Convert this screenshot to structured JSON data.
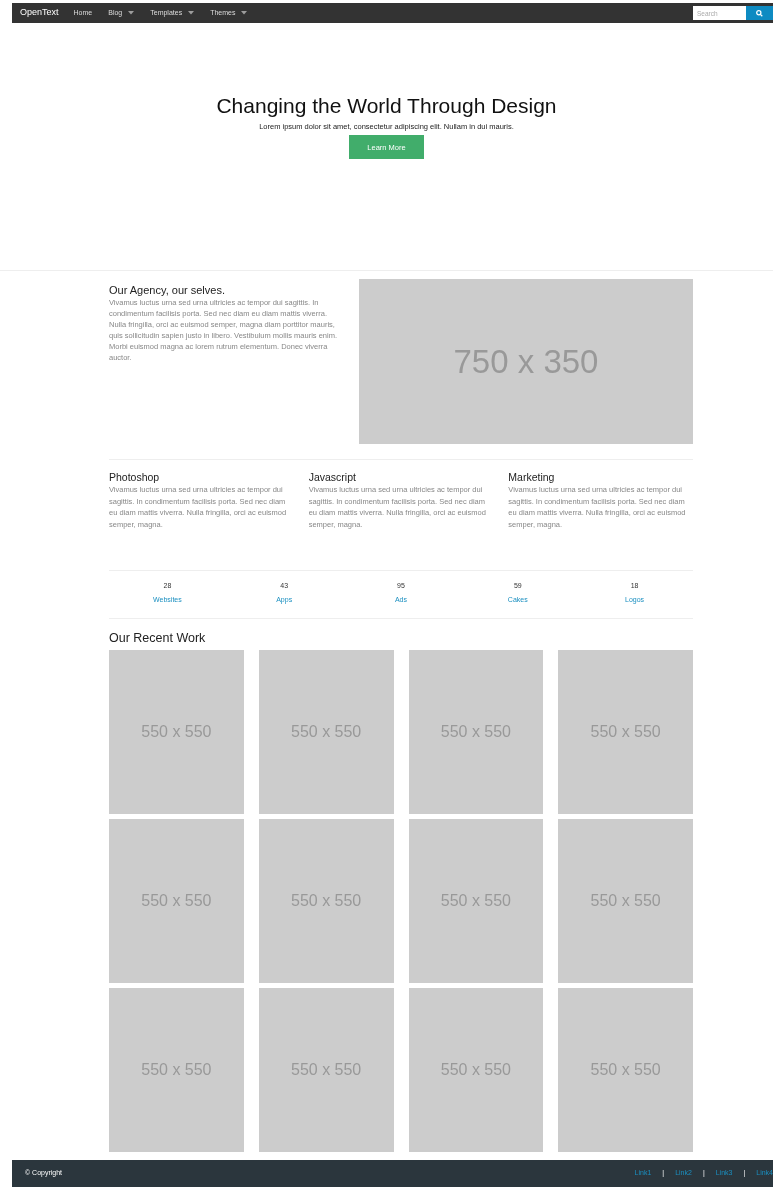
{
  "navbar": {
    "brand": "OpenText",
    "items": [
      {
        "label": "Home",
        "dropdown": false
      },
      {
        "label": "Blog",
        "dropdown": true
      },
      {
        "label": "Templates",
        "dropdown": true
      },
      {
        "label": "Themes",
        "dropdown": true
      }
    ],
    "search": {
      "placeholder": "Search"
    }
  },
  "hero": {
    "title": "Changing the World Through Design",
    "subtitle": "Lorem ipsum dolor sit amet, consectetur adipiscing elit. Nullam in dui mauris.",
    "button": "Learn More"
  },
  "agency": {
    "title": "Our Agency, our selves.",
    "text": "Vivamus luctus urna sed urna ultricies ac tempor dui sagittis. In condimentum facilisis porta. Sed nec diam eu diam mattis viverra. Nulla fringilla, orci ac euismod semper, magna diam porttitor mauris, quis sollicitudin sapien justo in libero. Vestibulum mollis mauris enim. Morbi euismod magna ac lorem rutrum elementum. Donec viverra auctor.",
    "image_label": "750 x 350"
  },
  "features": [
    {
      "title": "Photoshop",
      "text": "Vivamus luctus urna sed urna ultricies ac tempor dui sagittis. In condimentum facilisis porta. Sed nec diam eu diam mattis viverra. Nulla fringilla, orci ac euismod semper, magna."
    },
    {
      "title": "Javascript",
      "text": "Vivamus luctus urna sed urna ultricies ac tempor dui sagittis. In condimentum facilisis porta. Sed nec diam eu diam mattis viverra. Nulla fringilla, orci ac euismod semper, magna."
    },
    {
      "title": "Marketing",
      "text": "Vivamus luctus urna sed urna ultricies ac tempor dui sagittis. In condimentum facilisis porta. Sed nec diam eu diam mattis viverra. Nulla fringilla, orci ac euismod semper, magna."
    }
  ],
  "stats": [
    {
      "count": "28",
      "label": "Websites"
    },
    {
      "count": "43",
      "label": "Apps"
    },
    {
      "count": "95",
      "label": "Ads"
    },
    {
      "count": "59",
      "label": "Cakes"
    },
    {
      "count": "18",
      "label": "Logos"
    }
  ],
  "recent_work": {
    "title": "Our Recent Work",
    "tiles": [
      "550 x 550",
      "550 x 550",
      "550 x 550",
      "550 x 550",
      "550 x 550",
      "550 x 550",
      "550 x 550",
      "550 x 550",
      "550 x 550",
      "550 x 550",
      "550 x 550",
      "550 x 550"
    ]
  },
  "footer": {
    "copyright": "© Copyright",
    "items": [
      {
        "kind": "link",
        "text": "Link1"
      },
      {
        "kind": "separator",
        "text": "|"
      },
      {
        "kind": "link",
        "text": "Link2"
      },
      {
        "kind": "separator",
        "text": "|"
      },
      {
        "kind": "link",
        "text": "Link3"
      },
      {
        "kind": "separator",
        "text": "|"
      },
      {
        "kind": "link",
        "text": "Link4"
      }
    ]
  }
}
